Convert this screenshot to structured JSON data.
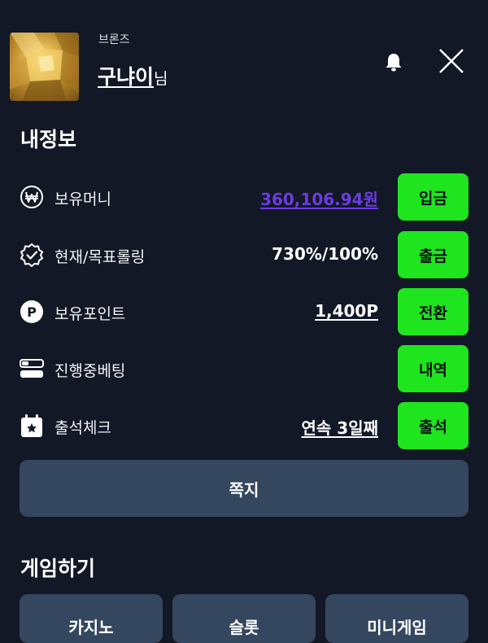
{
  "header": {
    "rank": "브론즈",
    "username": "구냐이",
    "username_suffix": "님"
  },
  "my_info": {
    "title": "내정보",
    "rows": [
      {
        "icon": "won-coin-icon",
        "label": "보유머니",
        "value": "360,106.94원",
        "button": "입금"
      },
      {
        "icon": "verified-badge-icon",
        "label": "현재/목표롤링",
        "value": "730%/100%",
        "button": "출금"
      },
      {
        "icon": "point-p-icon",
        "label": "보유포인트",
        "value": "1,400P",
        "button": "전환"
      },
      {
        "icon": "toggle-list-icon",
        "label": "진행중베팅",
        "value": "",
        "button": "내역"
      },
      {
        "icon": "calendar-star-icon",
        "label": "출석체크",
        "value": "연속 3일째",
        "button": "출석"
      }
    ],
    "memo_button": "쪽지"
  },
  "games": {
    "title": "게임하기",
    "buttons": [
      "카지노",
      "슬롯",
      "미니게임"
    ]
  },
  "colors": {
    "background": "#121826",
    "accent_green": "#1ee51e",
    "panel": "#34475f",
    "money_purple": "#6c3ce0"
  }
}
